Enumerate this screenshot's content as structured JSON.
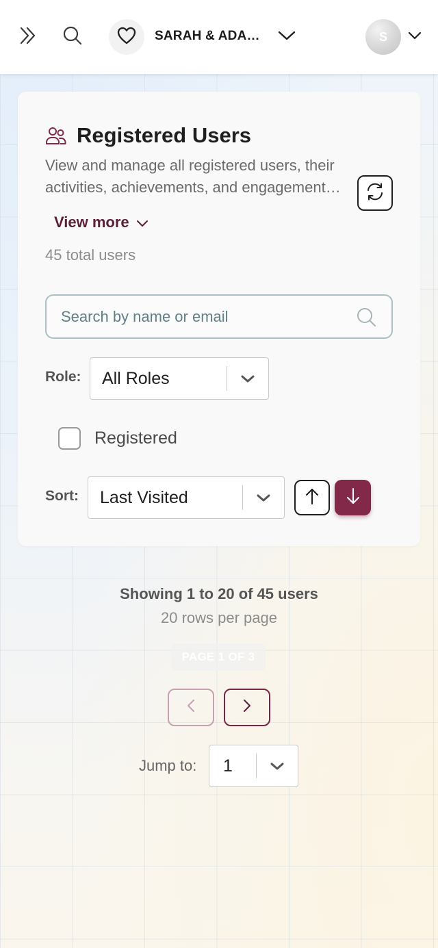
{
  "header": {
    "event_title": "SARAH & ADAM'...",
    "avatar_initial": "S"
  },
  "card": {
    "title": "Registered Users",
    "description": "View and manage all registered users, their activities, achievements, and engagement metrics across the event.",
    "view_more_label": "View more",
    "total_users": "45 total users",
    "search": {
      "placeholder": "Search by name or email",
      "value": ""
    },
    "role": {
      "label": "Role:",
      "selected": "All Roles"
    },
    "registered_filter": {
      "label": "Registered",
      "checked": false
    },
    "sort": {
      "label": "Sort:",
      "selected": "Last Visited",
      "direction": "desc"
    }
  },
  "pagination": {
    "showing": "Showing 1 to 20 of 45 users",
    "rows_per_page": "20 rows per page",
    "page_indicator": "PAGE 1 OF 3",
    "jump_label": "Jump to:",
    "jump_value": "1"
  },
  "colors": {
    "accent": "#82294a",
    "accent_dark": "#5a1f39",
    "search_border": "#a9bfc3"
  }
}
